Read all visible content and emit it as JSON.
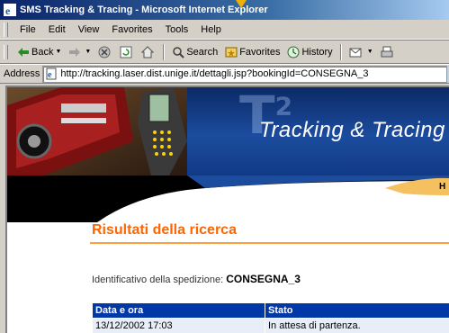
{
  "window": {
    "title": "SMS Tracking & Tracing - Microsoft Internet Explorer"
  },
  "menu": [
    "File",
    "Edit",
    "View",
    "Favorites",
    "Tools",
    "Help"
  ],
  "toolbar": {
    "back": "Back",
    "search": "Search",
    "favorites": "Favorites",
    "history": "History"
  },
  "address": {
    "label": "Address",
    "url": "http://tracking.laser.dist.unige.it/dettagli.jsp?bookingId=CONSEGNA_3"
  },
  "banner": {
    "logo_mark": "T",
    "logo_sup": "2",
    "title": "Tracking & Tracing",
    "nav_partial": "H"
  },
  "page": {
    "heading": "Risultati della ricerca",
    "ident_label": "Identificativo della spedizione:",
    "ident_value": "CONSEGNA_3",
    "table": {
      "headers": [
        "Data e ora",
        "Stato"
      ],
      "rows": [
        [
          "13/12/2002 17:03",
          "In attesa di partenza."
        ]
      ]
    }
  },
  "colors": {
    "accent": "#ff6600",
    "table_header": "#0038a8",
    "title_bar": "#0a246a"
  }
}
